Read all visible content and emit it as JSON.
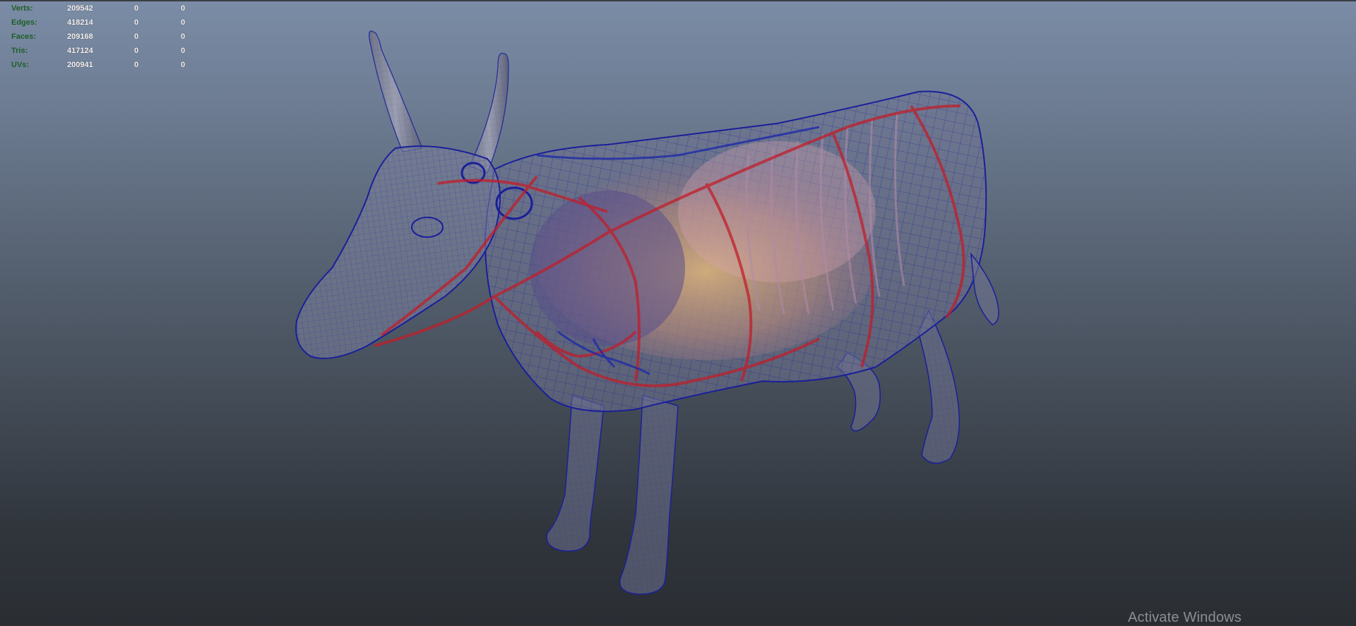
{
  "poly_count_hud": {
    "rows": [
      {
        "label": "Verts:",
        "total": "209542",
        "selected": "0",
        "components": "0"
      },
      {
        "label": "Edges:",
        "total": "418214",
        "selected": "0",
        "components": "0"
      },
      {
        "label": "Faces:",
        "total": "209168",
        "selected": "0",
        "components": "0"
      },
      {
        "label": "Tris:",
        "total": "417124",
        "selected": "0",
        "components": "0"
      },
      {
        "label": "UVs:",
        "total": "200941",
        "selected": "0",
        "components": "0"
      }
    ]
  },
  "viewport": {
    "subject": "cow-anatomy-wireframe",
    "colors": {
      "wireframe": "#1a1f9a",
      "vessels": "#c01e2a",
      "organs": "#d9a96a",
      "background_top": "#7b8ca6",
      "background_bottom": "#2a2e33"
    }
  },
  "system_overlay": {
    "watermark": "Activate Windows"
  }
}
